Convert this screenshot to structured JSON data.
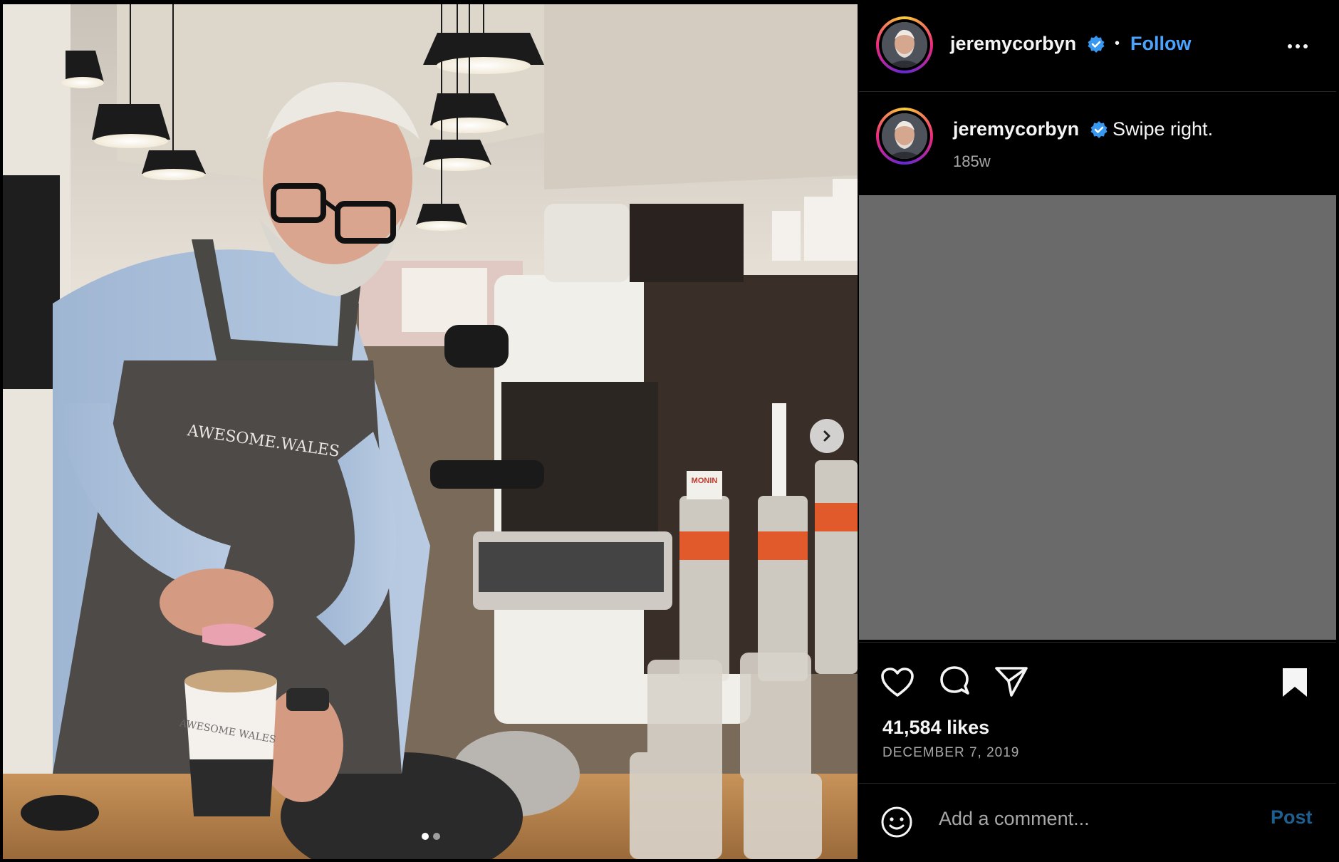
{
  "post": {
    "username": "jeremycorbyn",
    "separator": "•",
    "follow_label": "Follow",
    "more_icon": "more-horizontal-icon",
    "caption_username": "jeremycorbyn",
    "caption_text": "Swipe right.",
    "time_ago": "185w",
    "likes": "41,584 likes",
    "date": "DECEMBER 7, 2019",
    "carousel": {
      "current_slide": 1,
      "total_slides": 2
    },
    "photo_text": {
      "apron_logo": "AWESOME.WALES",
      "cup_logo": "AWESOME WALES",
      "syrup_label": "MONIN"
    }
  },
  "actions": {
    "like_icon": "heart-icon",
    "comment_icon": "comment-icon",
    "share_icon": "paper-plane-icon",
    "save_icon": "bookmark-icon"
  },
  "comment": {
    "emoji_icon": "emoji-icon",
    "placeholder": "Add a comment...",
    "post_label": "Post"
  },
  "colors": {
    "background": "#000000",
    "follow_blue": "#4aa3ff",
    "post_disabled": "#1f5f8f",
    "verified_blue": "#3897f0",
    "muted_text": "#a8a8a8",
    "comments_placeholder_bg": "#6a6a6a"
  }
}
